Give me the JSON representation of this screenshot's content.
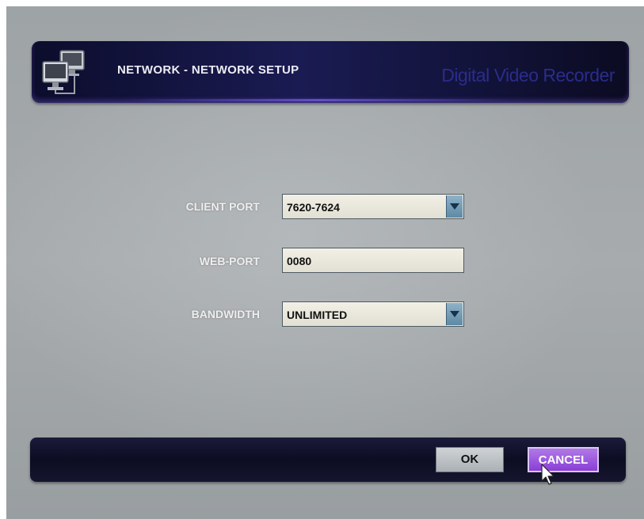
{
  "header": {
    "title": "NETWORK - NETWORK SETUP",
    "brand": "Digital Video Recorder"
  },
  "form": {
    "client_port": {
      "label": "CLIENT PORT",
      "value": "7620-7624"
    },
    "web_port": {
      "label": "WEB-PORT",
      "value": "0080"
    },
    "bandwidth": {
      "label": "BANDWIDTH",
      "value": "UNLIMITED"
    }
  },
  "footer": {
    "ok_label": "OK",
    "cancel_label": "CANCEL"
  },
  "colors": {
    "title_bar": "#1a1b52",
    "cancel_button": "#8a3ed6",
    "background": "#a7abad"
  },
  "icons": [
    "network-computers-icon",
    "dropdown-arrow-icon",
    "mouse-cursor-icon"
  ]
}
